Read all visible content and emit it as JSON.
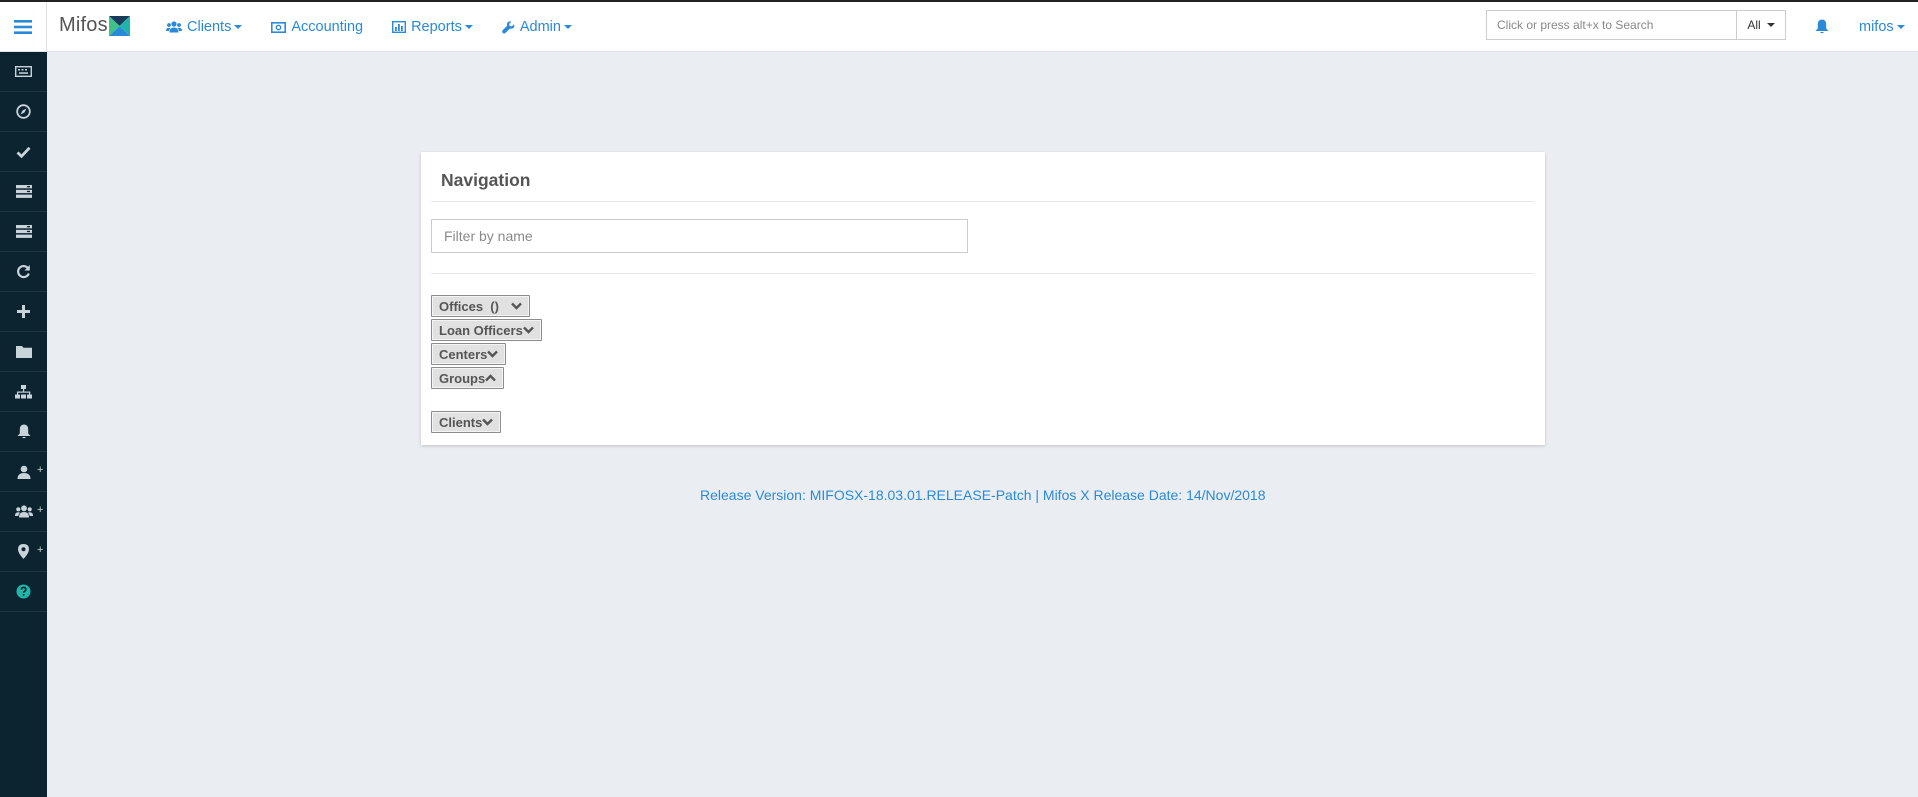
{
  "app": {
    "logo_text": "Mifos",
    "logo_icon": "mifos-x-logo"
  },
  "nav": {
    "clients": "Clients",
    "accounting": "Accounting",
    "reports": "Reports",
    "admin": "Admin"
  },
  "search": {
    "placeholder": "Click or press alt+x to Search",
    "scope": "All"
  },
  "user": {
    "name": "mifos"
  },
  "sidebar": {
    "items": [
      "keyboard-icon",
      "compass-icon",
      "check-icon",
      "server-icon",
      "server-icon",
      "refresh-icon",
      "plus-icon",
      "folder-icon",
      "sitemap-icon",
      "bell-icon",
      "user-add-icon",
      "group-add-icon",
      "map-marker-add-icon",
      "help-icon"
    ],
    "plus_label": "+"
  },
  "navigation": {
    "title": "Navigation",
    "filter_placeholder": "Filter by name",
    "buttons": {
      "offices": "Offices  ()",
      "loan_officers": "Loan Officers",
      "centers": "Centers",
      "groups": "Groups",
      "clients": "Clients"
    }
  },
  "footer": {
    "text": "Release Version: MIFOSX-18.03.01.RELEASE-Patch | Mifos X Release Date: 14/Nov/2018"
  },
  "colors": {
    "accent": "#2a8ad8",
    "sidebar_bg": "#0c2330",
    "page_bg": "#eaeef2",
    "help_icon": "#1fb5a8"
  }
}
